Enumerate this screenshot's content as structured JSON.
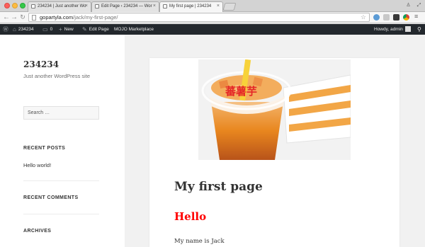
{
  "browser": {
    "tabs": [
      {
        "label": "234234 | Just another Wo"
      },
      {
        "label": "Edit Page ‹ 234234 — Wor"
      },
      {
        "label": "My first page | 234234"
      }
    ],
    "address": {
      "host": "gopartyla.com",
      "path": "/jack/my-first-page/"
    }
  },
  "adminbar": {
    "site_name": "234234",
    "comments_count": "0",
    "new_label": "New",
    "edit_label": "Edit Page",
    "marketplace_label": "MOJO Marketplace",
    "howdy": "Howdy, admin"
  },
  "sidebar": {
    "site_title": "234234",
    "site_description": "Just another WordPress site",
    "search_placeholder": "Search …",
    "recent_posts_title": "RECENT POSTS",
    "recent_posts": [
      "Hello world!"
    ],
    "recent_comments_title": "RECENT COMMENTS",
    "archives_title": "ARCHIVES"
  },
  "article": {
    "title": "My first page",
    "heading": "Hello",
    "body": "My name is Jack"
  },
  "image_text": "蕃薯芋",
  "colors": {
    "admin_bar": "#23282d",
    "hello_heading": "#ff0000",
    "drink_orange": "#e8861e"
  }
}
